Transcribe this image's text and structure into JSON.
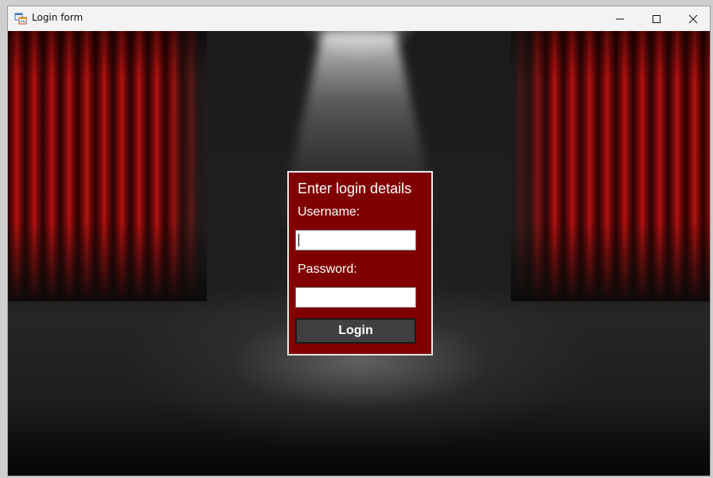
{
  "window": {
    "title": "Login form",
    "icon": "winforms-app-icon",
    "controls": {
      "minimize_icon": "minimize-icon",
      "maximize_icon": "maximize-icon",
      "close_icon": "close-icon"
    }
  },
  "background": {
    "scene": "theater-stage",
    "curtain_color": "#b31212",
    "floor_color": "#1e1e1e"
  },
  "login_panel": {
    "title": "Enter login details",
    "background_color": "#800000",
    "username_label": "Username:",
    "username_value": "",
    "password_label": "Password:",
    "password_value": "",
    "login_button_label": "Login",
    "button_color": "#404040"
  }
}
